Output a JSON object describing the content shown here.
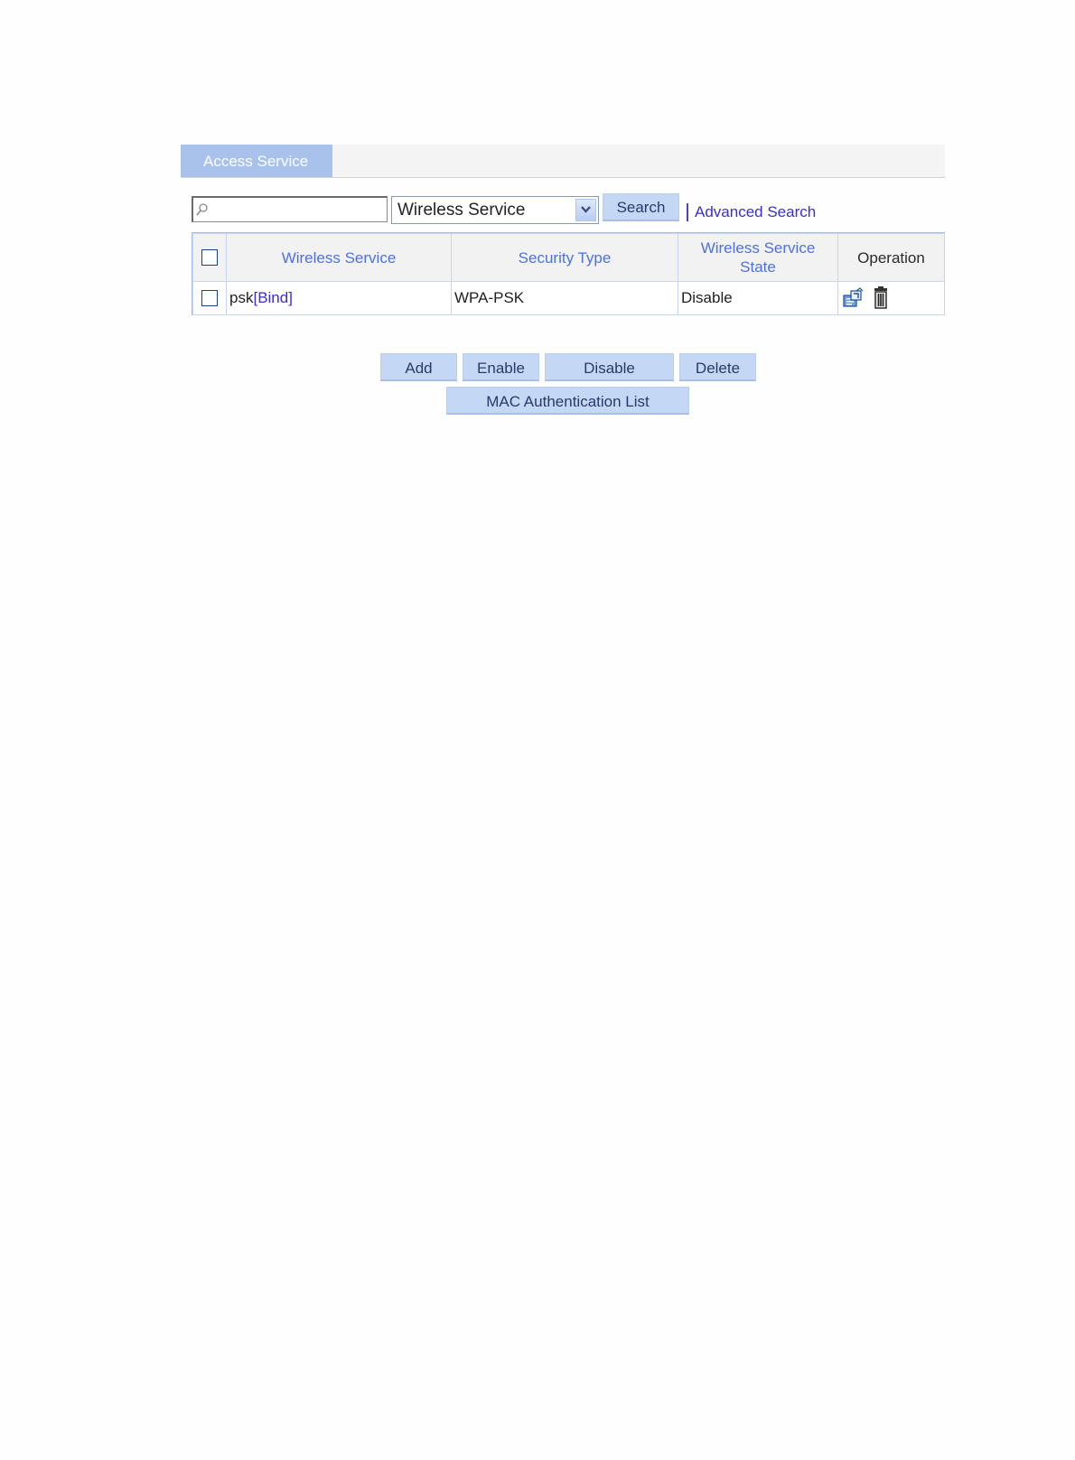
{
  "tabs": [
    {
      "label": "Access Service",
      "active": true
    }
  ],
  "search": {
    "value": "",
    "placeholder": "",
    "field_select": "Wireless Service",
    "search_label": "Search",
    "advanced_label": "Advanced Search"
  },
  "table": {
    "columns": {
      "wireless_service": "Wireless Service",
      "security_type": "Security Type",
      "state_line1": "Wireless Service",
      "state_line2": "State",
      "operation": "Operation"
    },
    "rows": [
      {
        "name": "psk",
        "bind_label": "[Bind]",
        "security_type": "WPA-PSK",
        "state": "Disable",
        "operations": [
          "edit-icon",
          "delete-icon"
        ]
      }
    ]
  },
  "actions": {
    "add": "Add",
    "enable": "Enable",
    "disable": "Disable",
    "delete": "Delete",
    "mac_list": "MAC Authentication List"
  },
  "colors": {
    "accent": "#a8c2ec",
    "button": "#c4d8f5",
    "link": "#3a2fd0",
    "header_text": "#4d72db"
  }
}
